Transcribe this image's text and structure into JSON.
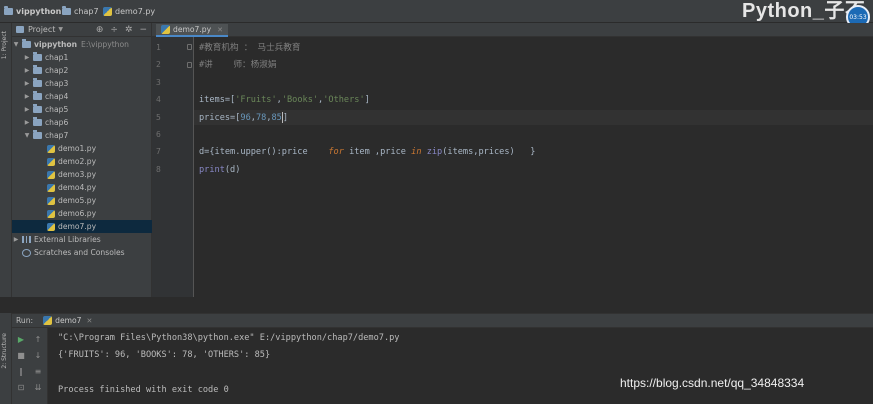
{
  "breadcrumb": {
    "project": "vippython",
    "folder": "chap7",
    "file": "demo7.py"
  },
  "overlay_title": "Python_子不",
  "timer": "03:53",
  "left_strip": {
    "project_tab": "1: Project",
    "structure_tab": "2: Structure"
  },
  "project_panel": {
    "title": "Project",
    "root": {
      "name": "vippython",
      "path": "E:\\vippython"
    },
    "folders": [
      "chap1",
      "chap2",
      "chap3",
      "chap4",
      "chap5",
      "chap6",
      "chap7"
    ],
    "files": [
      "demo1.py",
      "demo2.py",
      "demo3.py",
      "demo4.py",
      "demo5.py",
      "demo6.py",
      "demo7.py"
    ],
    "external_libraries": "External Libraries",
    "scratches": "Scratches and Consoles"
  },
  "editor": {
    "tab": "demo7.py",
    "line_numbers": [
      "1",
      "2",
      "3",
      "4",
      "5",
      "6",
      "7",
      "8"
    ],
    "line1_comment": "#教育机构 ： 马士兵教育",
    "line2_comment": "#讲    师：杨淑娟",
    "line4": {
      "var": "items",
      "op": "=[",
      "s1": "'Fruits'",
      "s2": "'Books'",
      "s3": "'Others'",
      "close": "]"
    },
    "line5": {
      "var": "prices",
      "op": "=[",
      "n1": "96",
      "n2": "78",
      "n3": "85",
      "close": "]"
    },
    "line7": {
      "a": "d={item.upper():price",
      "for": "for",
      "b": " item ,price ",
      "in": "in",
      "zip": "zip",
      "c": "(items,prices)",
      "close": "}"
    },
    "line8": {
      "print": "print",
      "arg": "(d)"
    }
  },
  "run_panel": {
    "label": "Run:",
    "tab": "demo7",
    "command": "\"C:\\Program Files\\Python38\\python.exe\" E:/vippython/chap7/demo7.py",
    "output": "{'FRUITS': 96, 'BOOKS': 78, 'OTHERS': 85}",
    "exit": "Process finished with exit code 0"
  },
  "watermark": "https://blog.csdn.net/qq_34848334",
  "colors": {
    "background": "#2b2b2b",
    "panel": "#3c3f41",
    "comment": "#808080",
    "string": "#6a8759",
    "number": "#6897bb",
    "keyword": "#cc7832",
    "selection": "#0d293e"
  }
}
